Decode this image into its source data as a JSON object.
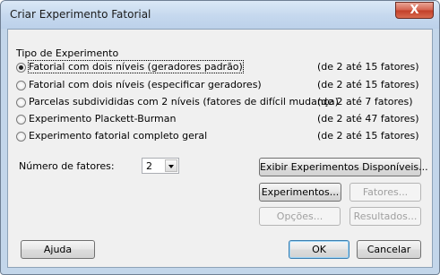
{
  "window": {
    "title": "Criar Experimento Fatorial",
    "close_label": "X"
  },
  "design_type": {
    "label": "Tipo de Experimento",
    "options": [
      {
        "label": "Fatorial com dois níveis (geradores padrão)",
        "range": "(de 2 até 15 fatores)",
        "selected": true
      },
      {
        "label": "Fatorial com dois níveis (especificar geradores)",
        "range": "(de 2 até 15 fatores)",
        "selected": false
      },
      {
        "label": "Parcelas subdivididas com 2 níveis (fatores de difícil mudança)",
        "range": "(de 2 até 7 fatores)",
        "selected": false
      },
      {
        "label": "Experimento Plackett-Burman",
        "range": "(de 2 até 47 fatores)",
        "selected": false
      },
      {
        "label": "Experimento fatorial completo geral",
        "range": "(de 2 até 15 fatores)",
        "selected": false
      }
    ]
  },
  "factors": {
    "label": "Número de fatores:",
    "value": "2"
  },
  "buttons": {
    "show_designs": "Exibir Experimentos Disponíveis...",
    "designs": "Experimentos...",
    "factors": "Fatores...",
    "options": "Opções...",
    "results": "Resultados...",
    "help": "Ajuda",
    "ok": "OK",
    "cancel": "Cancelar"
  }
}
